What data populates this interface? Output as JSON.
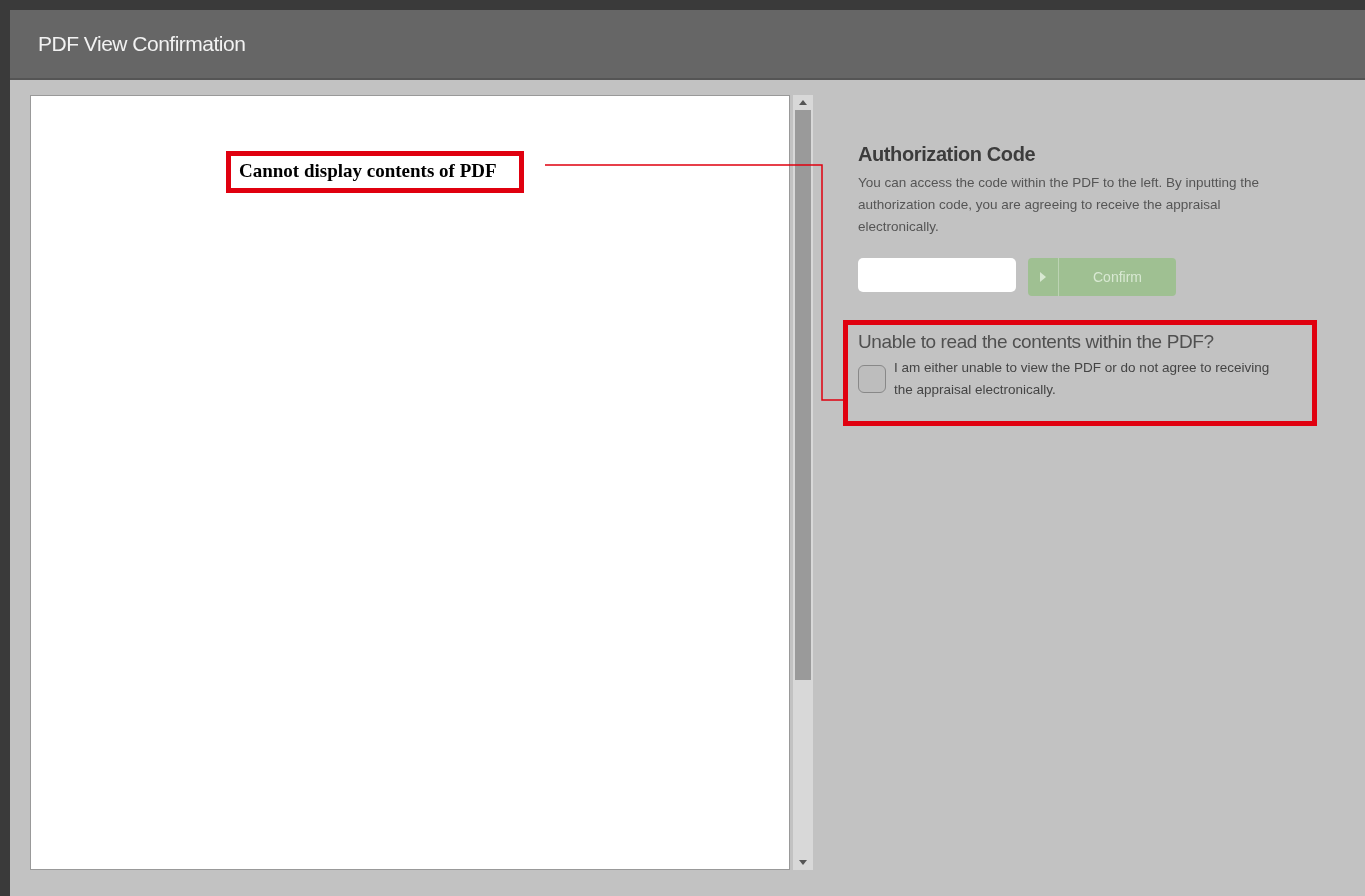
{
  "window": {
    "title": "PDF View Confirmation"
  },
  "pdf_viewer": {
    "message": "Cannot display contents of PDF"
  },
  "authorization": {
    "heading": "Authorization Code",
    "description": "You can access the code within the PDF to the left. By inputting the authorization code, you are agreeing to receive the appraisal electronically.",
    "confirm_button": {
      "label": "Confirm",
      "disabled": true
    }
  },
  "unable": {
    "heading": "Unable to read the contents within the PDF?",
    "checkbox": {
      "label": "I am either unable to view the PDF or do not agree to receiving the appraisal electronically.",
      "checked": false
    }
  }
}
